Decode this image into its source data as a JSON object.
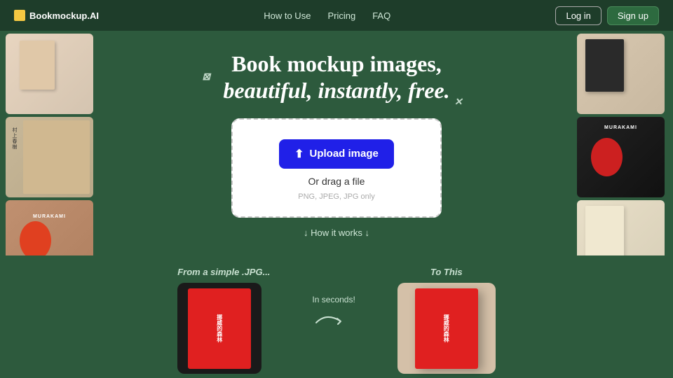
{
  "nav": {
    "logo": "📚 Bookmockup.AI",
    "logo_label": "Bookmockup.AI",
    "links": [
      {
        "label": "How to Use",
        "href": "#"
      },
      {
        "label": "Pricing",
        "href": "#"
      },
      {
        "label": "FAQ",
        "href": "#"
      }
    ],
    "login_label": "Log in",
    "signup_label": "Sign up"
  },
  "hero": {
    "heading_line1": "Book mockup images,",
    "heading_line2": "beautiful, instantly, free.",
    "deco1": "⊠",
    "deco2": "☺",
    "deco3": "✕"
  },
  "upload": {
    "button_label": "Upload image",
    "drag_text": "Or drag a file",
    "file_types": "PNG, JPEG, JPG only"
  },
  "how_it_works": {
    "label": "↓ How it works ↓"
  },
  "bottom": {
    "from_label": "From a simple .JPG...",
    "to_label": "To This",
    "arrow_label": "In seconds!",
    "from_book_text": "挪威的森林",
    "to_book_text": "挪威的森林"
  }
}
